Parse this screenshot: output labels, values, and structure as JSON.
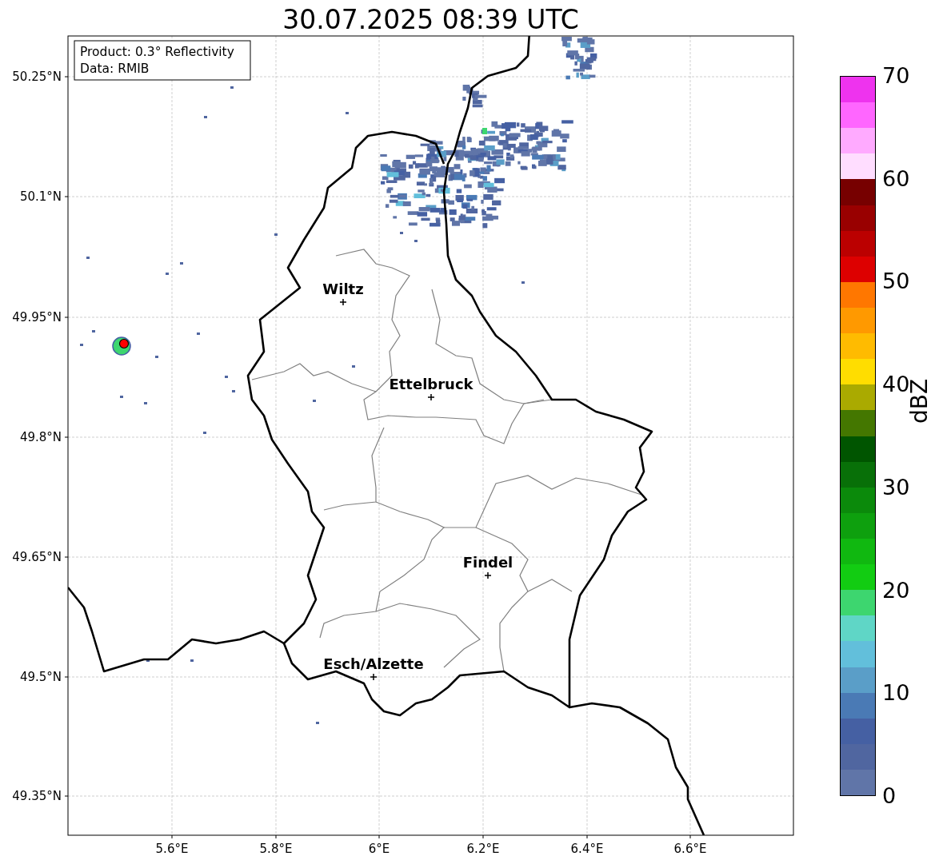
{
  "title": "30.07.2025 08:39 UTC",
  "map": {
    "x_tick_labels": [
      "5.6°E",
      "5.8°E",
      "6°E",
      "6.2°E",
      "6.4°E",
      "6.6°E"
    ],
    "y_tick_labels": [
      "50.25°N",
      "50.1°N",
      "49.95°N",
      "49.8°N",
      "49.65°N",
      "49.5°N",
      "49.35°N"
    ],
    "cities": [
      "Wiltz",
      "Ettelbruck",
      "Findel",
      "Esch/Alzette"
    ],
    "info_box": [
      "Product: 0.3° Reflectivity",
      "Data: RMIB"
    ]
  },
  "colorbar": {
    "label": "dBZ",
    "ticks": [
      "70",
      "60",
      "50",
      "40",
      "30",
      "20",
      "10",
      "0"
    ],
    "bins": [
      {
        "color": "#ee33ee"
      },
      {
        "color": "#ff66ff"
      },
      {
        "color": "#ffaaff"
      },
      {
        "color": "#ffddff"
      },
      {
        "color": "#770000"
      },
      {
        "color": "#990000"
      },
      {
        "color": "#bb0000"
      },
      {
        "color": "#dd0000"
      },
      {
        "color": "#ff7700"
      },
      {
        "color": "#ff9900"
      },
      {
        "color": "#ffbb00"
      },
      {
        "color": "#ffdd00"
      },
      {
        "color": "#aaaa00"
      },
      {
        "color": "#447700"
      },
      {
        "color": "#005500"
      },
      {
        "color": "#087008"
      },
      {
        "color": "#0b8a0b"
      },
      {
        "color": "#0ea00e"
      },
      {
        "color": "#10b810"
      },
      {
        "color": "#12cc12"
      },
      {
        "color": "#3dd66f"
      },
      {
        "color": "#5fd6c6"
      },
      {
        "color": "#62bfdb"
      },
      {
        "color": "#5a9ec8"
      },
      {
        "color": "#4a7ab5"
      },
      {
        "color": "#4560a3"
      },
      {
        "color": "#5066a0"
      },
      {
        "color": "#6075a8"
      }
    ]
  }
}
